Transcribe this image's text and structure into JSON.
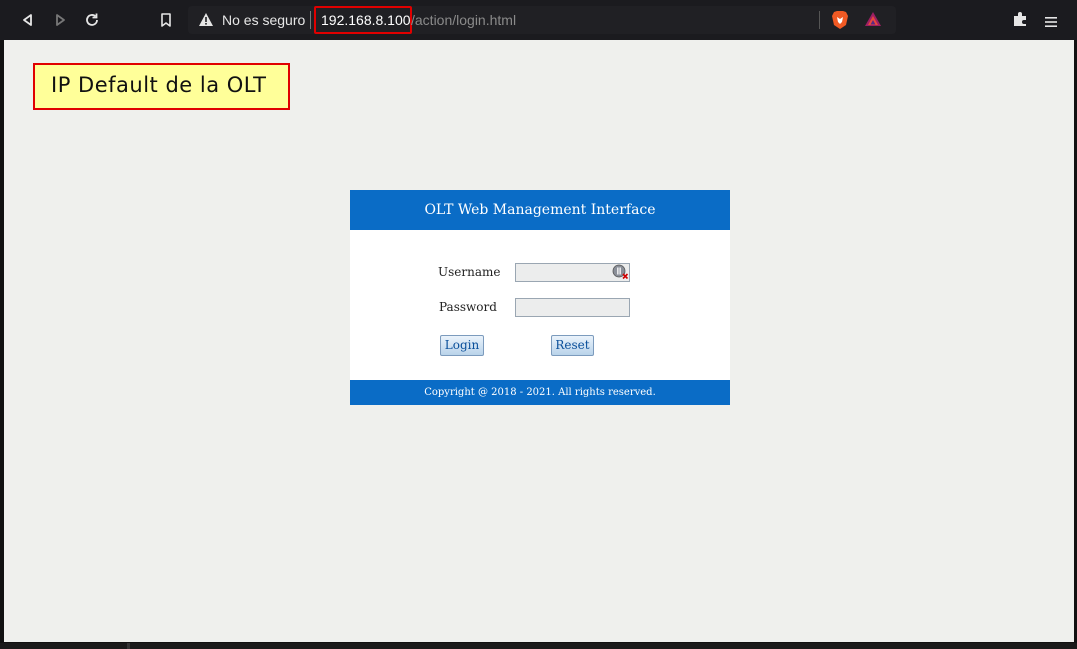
{
  "browser": {
    "security_label": "No es seguro",
    "url_host": "192.168.8.100",
    "url_path": "/action/login.html"
  },
  "annotation": {
    "text": "IP Default de la OLT",
    "colors": {
      "border": "#e00000",
      "fill": "#ffff99"
    }
  },
  "login": {
    "title": "OLT Web Management Interface",
    "username_label": "Username",
    "password_label": "Password",
    "username_value": "",
    "password_value": "",
    "login_button": "Login",
    "reset_button": "Reset",
    "footer": "Copyright @ 2018 - 2021. All rights reserved.",
    "colors": {
      "header": "#0a6cc6",
      "button_text": "#0a4f9a"
    }
  },
  "icons": {
    "back": "back-arrow-icon",
    "forward": "forward-arrow-icon",
    "reload": "reload-icon",
    "bookmark": "bookmark-icon",
    "warning": "warning-icon",
    "brave": "brave-lion-icon",
    "rewards": "brave-rewards-icon",
    "extensions": "puzzle-piece-icon",
    "menu": "hamburger-menu-icon",
    "password_manager": "password-manager-icon"
  }
}
